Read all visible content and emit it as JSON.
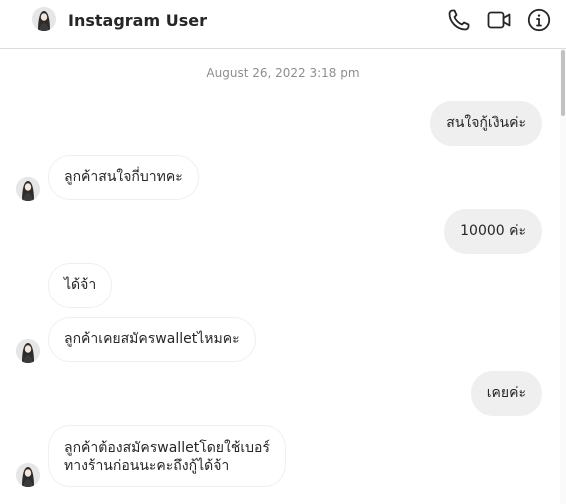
{
  "header": {
    "username": "Instagram User",
    "avatar_icon": "user-avatar-icon",
    "icons": [
      "phone-icon",
      "video-icon",
      "info-icon"
    ]
  },
  "thread": {
    "timestamp": "August 26, 2022 3:18 pm",
    "messages": [
      {
        "direction": "out",
        "text": "สนใจกู้เงินค่ะ"
      },
      {
        "direction": "in",
        "text": "ลูกค้าสนใจกี่บาทคะ"
      },
      {
        "direction": "out",
        "text": "10000 ค่ะ"
      },
      {
        "direction": "in",
        "text": "ได้จ้า"
      },
      {
        "direction": "in",
        "text": "ลูกค้าเคยสมัครwalletไหมคะ"
      },
      {
        "direction": "out",
        "text": "เคยค่ะ"
      },
      {
        "direction": "in",
        "lines": [
          "ลูกค้าต้องสมัครwalletโดยใช้เบอร์",
          "ทางร้านก่อนนะคะถึงกู้ได้จ้า"
        ]
      }
    ]
  },
  "colors": {
    "outgoing_bubble": "#efefef",
    "incoming_border": "#efefef",
    "text": "#262626",
    "timestamp": "#8e8e8e",
    "divider": "#dbdbdb"
  }
}
